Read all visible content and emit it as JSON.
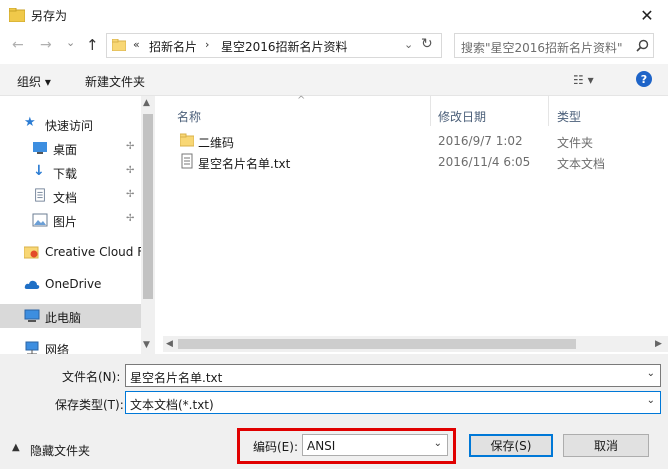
{
  "window": {
    "title": "另存为",
    "close": "✕"
  },
  "nav": {
    "back": "←",
    "forward": "→",
    "recent": "⌄",
    "up": "↑",
    "refresh": "↻",
    "address_dropdown": "⌄"
  },
  "address": {
    "overflow": "«",
    "crumbs": [
      "招新名片",
      "星空2016招新名片资料"
    ],
    "separator": "›"
  },
  "search": {
    "placeholder": "搜索\"星空2016招新名片资料\""
  },
  "toolbar": {
    "organize": "组织 ▾",
    "new_folder": "新建文件夹",
    "view": "☷ ▾",
    "help": "?"
  },
  "sidebar": {
    "items": [
      {
        "label": "快速访问",
        "icon": "star-icon"
      },
      {
        "label": "桌面",
        "icon": "desktop-icon",
        "pinned": true
      },
      {
        "label": "下载",
        "icon": "download-icon",
        "pinned": true
      },
      {
        "label": "文档",
        "icon": "document-icon",
        "pinned": true
      },
      {
        "label": "图片",
        "icon": "picture-icon",
        "pinned": true
      },
      {
        "label": "Creative Cloud F",
        "icon": "creative-cloud-icon"
      },
      {
        "label": "OneDrive",
        "icon": "onedrive-icon"
      },
      {
        "label": "此电脑",
        "icon": "computer-icon",
        "selected": true
      },
      {
        "label": "网络",
        "icon": "network-icon"
      }
    ],
    "pin_glyph": "✢"
  },
  "filelist": {
    "columns": [
      "名称",
      "修改日期",
      "类型"
    ],
    "sort_indicator": "^",
    "rows": [
      {
        "name": "二维码",
        "date": "2016/9/7 1:02",
        "type": "文件夹",
        "icon": "folder-icon"
      },
      {
        "name": "星空名片名单.txt",
        "date": "2016/11/4 6:05",
        "type": "文本文档",
        "icon": "text-file-icon"
      }
    ]
  },
  "form": {
    "filename_label": "文件名(N):",
    "filename_value": "星空名片名单.txt",
    "filetype_label": "保存类型(T):",
    "filetype_value": "文本文档(*.txt)",
    "hide_folders": "隐藏文件夹",
    "encoding_label": "编码(E):",
    "encoding_value": "ANSI",
    "save": "保存(S)",
    "cancel": "取消",
    "dropdown_glyph": "⌄"
  },
  "colors": {
    "highlight": "#e00000",
    "accent": "#0078d7",
    "help": "#1e64c8",
    "folder": "#f8d775"
  }
}
